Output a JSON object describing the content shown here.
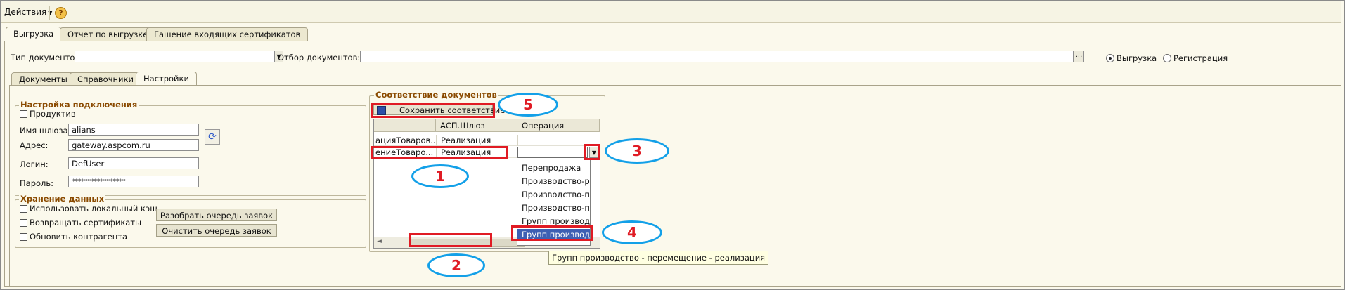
{
  "toolbar": {
    "actions_label": "Действия",
    "help_icon": "question-circle-icon",
    "help_text": "?"
  },
  "top_tabs": [
    {
      "label": "Выгрузка",
      "active": true
    },
    {
      "label": "Отчет по выгрузке",
      "active": false
    },
    {
      "label": "Гашение входящих сертификатов",
      "active": false
    }
  ],
  "filters": {
    "doc_type_label": "Тип документов:",
    "doc_type_value": "",
    "doc_filter_label": "Отбор документов:",
    "doc_filter_value": "",
    "ellipsis": "...",
    "radio_export": "Выгрузка",
    "radio_register": "Регистрация",
    "radio_selected": "export"
  },
  "sub_tabs": [
    {
      "label": "Документы",
      "active": false
    },
    {
      "label": "Справочники",
      "active": false
    },
    {
      "label": "Настройки",
      "active": true
    }
  ],
  "connection": {
    "title": "Настройка подключения",
    "productive_label": "Продуктив",
    "productive_checked": false,
    "gateway_label": "Имя шлюза:",
    "gateway_value": "alians",
    "address_label": "Адрес:",
    "address_value": "gateway.aspcom.ru",
    "login_label": "Логин:",
    "login_value": "DefUser",
    "password_label": "Пароль:",
    "password_value": "*****************",
    "refresh_icon": "refresh-icon"
  },
  "storage": {
    "title": "Хранение данных",
    "use_local_cache": "Использовать локальный кэш",
    "return_certificates": "Возвращать сертификаты",
    "update_counterparty": "Обновить контрагента",
    "parse_queue_button": "Разобрать очередь заявок",
    "clear_queue_button": "Очистить очередь заявок"
  },
  "mapping": {
    "title": "Соответствие документов",
    "save_button": "Сохранить соответствие",
    "save_icon": "save-disk-icon",
    "columns": [
      "",
      "АСП.Шлюз",
      "Операция"
    ],
    "rows": [
      [
        "ацияТоваров...",
        "Реализация",
        ""
      ],
      [
        "ениеТоваро...",
        "Реализация",
        ""
      ]
    ],
    "dropdown_items": [
      "Перепродажа",
      "Производство-р...",
      "Производство-п...",
      "Производство-п...",
      "Групп производс...",
      "Групп производс..."
    ],
    "selected_index": 5,
    "tooltip": "Групп производство - перемещение - реализация"
  },
  "annotations": [
    {
      "num": "1"
    },
    {
      "num": "2"
    },
    {
      "num": "3"
    },
    {
      "num": "4"
    },
    {
      "num": "5"
    }
  ],
  "colors": {
    "accent_red": "#e01b24",
    "accent_blue": "#13a0e8",
    "group_title": "#8a4a00",
    "selected_bg": "#3d5fb3"
  }
}
